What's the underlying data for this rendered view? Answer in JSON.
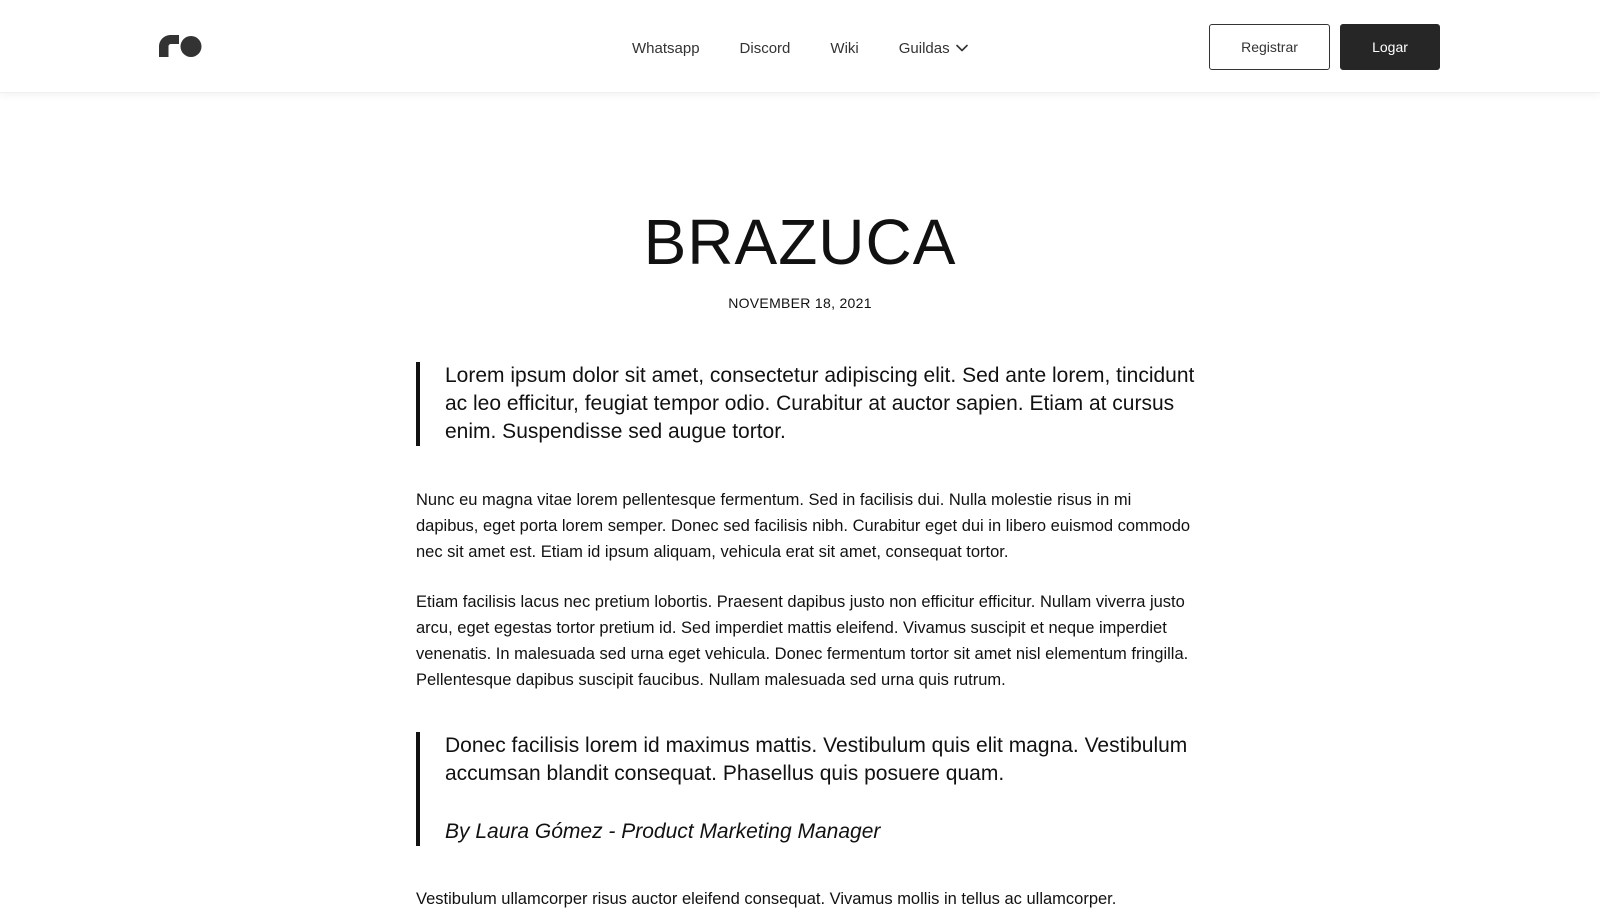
{
  "header": {
    "logo_icon": "brand-logo-icon",
    "nav": {
      "items": [
        {
          "label": "Whatsapp"
        },
        {
          "label": "Discord"
        },
        {
          "label": "Wiki"
        },
        {
          "label": "Guildas",
          "icon": "chevron-down-icon"
        }
      ]
    },
    "register_label": "Registrar",
    "login_label": "Logar"
  },
  "article": {
    "title": "BRAZUCA",
    "date": "NOVEMBER 18, 2021",
    "quote1": "Lorem ipsum dolor sit amet, consectetur adipiscing elit. Sed ante lorem, tincidunt ac leo efficitur, feugiat tempor odio. Curabitur at auctor sapien. Etiam at cursus enim. Suspendisse sed augue tortor.",
    "paragraph1": "Nunc eu magna vitae lorem pellentesque fermentum. Sed in facilisis dui. Nulla molestie risus in mi dapibus, eget porta lorem semper. Donec sed facilisis nibh. Curabitur eget dui in libero euismod commodo nec sit amet est. Etiam id ipsum aliquam, vehicula erat sit amet, consequat tortor.",
    "paragraph2": "Etiam facilisis lacus nec pretium lobortis. Praesent dapibus justo non efficitur efficitur. Nullam viverra justo arcu, eget egestas tortor pretium id. Sed imperdiet mattis eleifend. Vivamus suscipit et neque imperdiet venenatis. In malesuada sed urna eget vehicula. Donec fermentum tortor sit amet nisl elementum fringilla. Pellentesque dapibus suscipit faucibus. Nullam malesuada sed urna quis rutrum.",
    "quote2": "Donec facilisis lorem id maximus mattis. Vestibulum quis elit magna. Vestibulum accumsan blandit consequat. Phasellus quis posuere quam.",
    "quote2_author": "By Laura Gómez - Product Marketing Manager",
    "paragraph3": "Vestibulum ullamcorper risus auctor eleifend consequat. Vivamus mollis in tellus ac ullamcorper."
  },
  "colors": {
    "text": "#111111",
    "login_button_bg": "#262626",
    "nav_text": "#333333"
  }
}
